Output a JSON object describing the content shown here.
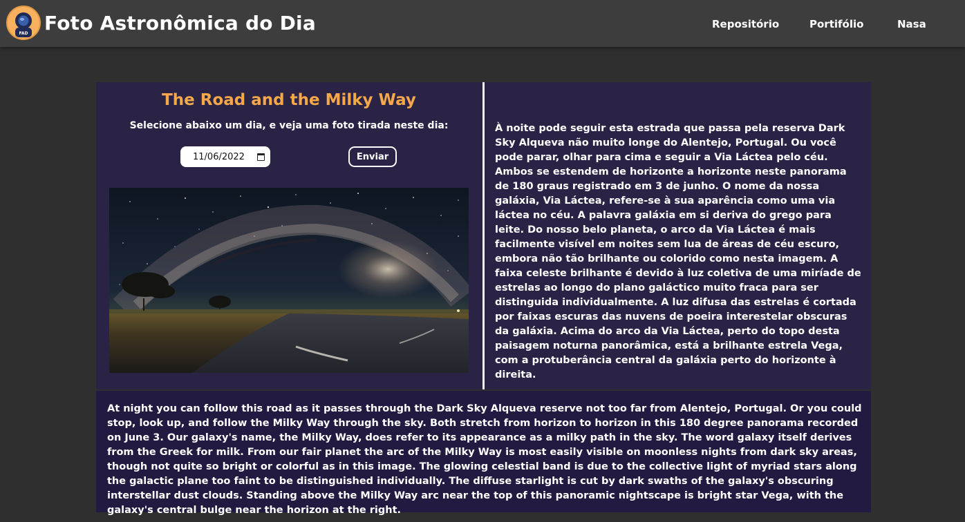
{
  "header": {
    "logo_label": "FAD",
    "title": "Foto Astronômica do Dia",
    "nav": [
      {
        "label": "Repositório"
      },
      {
        "label": "Portifólio"
      },
      {
        "label": "Nasa"
      }
    ]
  },
  "apod": {
    "title": "The Road and the Milky Way",
    "prompt": "Selecione abaixo um dia, e veja uma foto tirada neste dia:",
    "date_value": "11/06/2022",
    "submit_label": "Enviar",
    "image_icon": "milky-way-panorama",
    "explanation_pt": "À noite pode seguir esta estrada que passa pela reserva Dark Sky Alqueva não muito longe do Alentejo, Portugal. Ou você pode parar, olhar para cima e seguir a Via Láctea pelo céu. Ambos se estendem de horizonte a horizonte neste panorama de 180 graus registrado em 3 de junho. O nome da nossa galáxia, Via Láctea, refere-se à sua aparência como uma via láctea no céu. A palavra galáxia em si deriva do grego para leite. Do nosso belo planeta, o arco da Via Láctea é mais facilmente visível em noites sem lua de áreas de céu escuro, embora não tão brilhante ou colorido como nesta imagem. A faixa celeste brilhante é devido à luz coletiva de uma miríade de estrelas ao longo do plano galáctico muito fraca para ser distinguida individualmente. A luz difusa das estrelas é cortada por faixas escuras das nuvens de poeira interestelar obscuras da galáxia. Acima do arco da Via Láctea, perto do topo desta paisagem noturna panorâmica, está a brilhante estrela Vega, com a protuberância central da galáxia perto do horizonte à direita.",
    "explanation_en": "At night you can follow this road as it passes through the Dark Sky Alqueva reserve not too far from Alentejo, Portugal. Or you could stop, look up, and follow the Milky Way through the sky. Both stretch from horizon to horizon in this 180 degree panorama recorded on June 3. Our galaxy's name, the Milky Way, does refer to its appearance as a milky path in the sky. The word galaxy itself derives from the Greek for milk. From our fair planet the arc of the Milky Way is most easily visible on moonless nights from dark sky areas, though not quite so bright or colorful as in this image. The glowing celestial band is due to the collective light of myriad stars along the galactic plane too faint to be distinguished individually. The diffuse starlight is cut by dark swaths of the galaxy's obscuring interstellar dust clouds. Standing above the Milky Way arc near the top of this panoramic nightscape is bright star Vega, with the galaxy's central bulge near the horizon at the right."
  },
  "colors": {
    "page_bg": "#2f2f2f",
    "header_bg": "#3d3d3d",
    "card_bg": "#2a2346",
    "english_box_bg": "#221a40",
    "title_accent": "#f5a84a",
    "logo_bg": "#f7b15f"
  }
}
